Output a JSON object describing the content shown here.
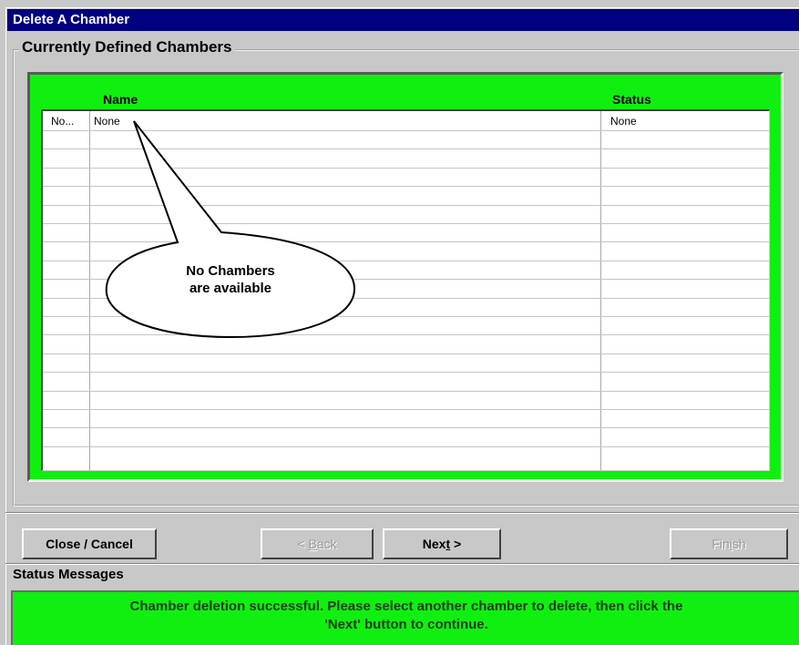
{
  "window": {
    "title": "Delete A Chamber"
  },
  "group": {
    "legend": "Currently Defined Chambers"
  },
  "grid": {
    "columns": [
      {
        "label": ""
      },
      {
        "label": "Name"
      },
      {
        "label": "Status"
      }
    ],
    "rows": [
      {
        "id": "No...",
        "name": "None",
        "status": "None"
      }
    ]
  },
  "callout": {
    "line1": "No Chambers",
    "line2": "are available"
  },
  "buttons": {
    "close_cancel": "Close / Cancel",
    "back_prefix": "< ",
    "back_mnemonic": "B",
    "back_suffix": "ack",
    "next_prefix": "Nex",
    "next_mnemonic": "t",
    "next_suffix": " >",
    "finish_prefix": "Fin",
    "finish_mnemonic": "i",
    "finish_suffix": "sh"
  },
  "status": {
    "label": "Status Messages",
    "line1": "Chamber deletion successful. Please select another chamber to delete, then click the",
    "line2": "'Next' button to continue."
  },
  "colors": {
    "title_bar": "#000080",
    "panel_green": "#10f010",
    "window_gray": "#c8c8c8"
  }
}
